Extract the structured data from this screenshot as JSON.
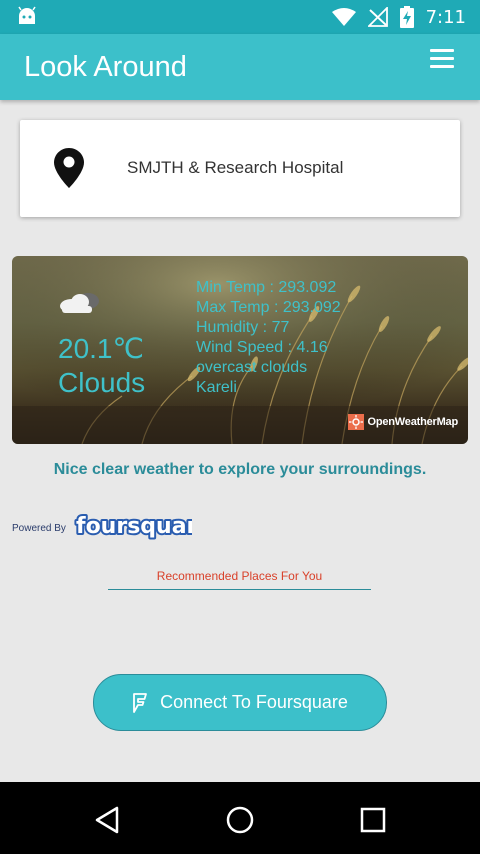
{
  "status_bar": {
    "time": "7:11"
  },
  "app": {
    "title": "Look Around"
  },
  "location": {
    "name": "SMJTH & Research Hospital"
  },
  "weather": {
    "temp": "20.1℃",
    "condition": "Clouds",
    "details": [
      "Min Temp : 293.092",
      "Max Temp : 293.092",
      "Humidity : 77",
      "Wind Speed : 4.16",
      "overcast clouds",
      "Kareli"
    ],
    "provider": "OpenWeatherMap"
  },
  "tagline": "Nice clear weather to explore your surroundings.",
  "powered": {
    "label": "Powered By",
    "brand": "foursquare"
  },
  "recommended": {
    "label": "Recommended Places For You"
  },
  "connect": {
    "label": "Connect To Foursquare"
  },
  "colors": {
    "primary": "#3cc0ca",
    "primary_dark": "#1faab6",
    "accent_text": "#2b8c99",
    "rec_label": "#d9412a"
  }
}
